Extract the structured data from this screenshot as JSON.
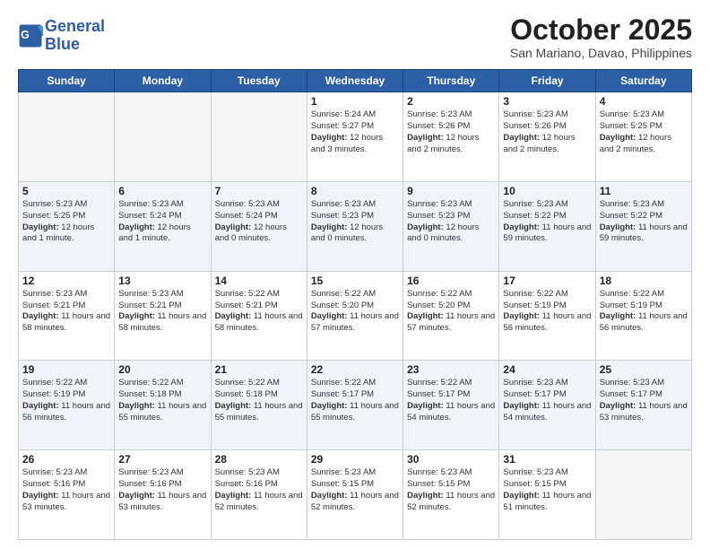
{
  "header": {
    "logo_line1": "General",
    "logo_line2": "Blue",
    "month": "October 2025",
    "location": "San Mariano, Davao, Philippines"
  },
  "weekdays": [
    "Sunday",
    "Monday",
    "Tuesday",
    "Wednesday",
    "Thursday",
    "Friday",
    "Saturday"
  ],
  "weeks": [
    [
      {
        "day": "",
        "text": ""
      },
      {
        "day": "",
        "text": ""
      },
      {
        "day": "",
        "text": ""
      },
      {
        "day": "1",
        "text": "Sunrise: 5:24 AM\nSunset: 5:27 PM\nDaylight: 12 hours and 3 minutes."
      },
      {
        "day": "2",
        "text": "Sunrise: 5:23 AM\nSunset: 5:26 PM\nDaylight: 12 hours and 2 minutes."
      },
      {
        "day": "3",
        "text": "Sunrise: 5:23 AM\nSunset: 5:26 PM\nDaylight: 12 hours and 2 minutes."
      },
      {
        "day": "4",
        "text": "Sunrise: 5:23 AM\nSunset: 5:25 PM\nDaylight: 12 hours and 2 minutes."
      }
    ],
    [
      {
        "day": "5",
        "text": "Sunrise: 5:23 AM\nSunset: 5:25 PM\nDaylight: 12 hours and 1 minute."
      },
      {
        "day": "6",
        "text": "Sunrise: 5:23 AM\nSunset: 5:24 PM\nDaylight: 12 hours and 1 minute."
      },
      {
        "day": "7",
        "text": "Sunrise: 5:23 AM\nSunset: 5:24 PM\nDaylight: 12 hours and 0 minutes."
      },
      {
        "day": "8",
        "text": "Sunrise: 5:23 AM\nSunset: 5:23 PM\nDaylight: 12 hours and 0 minutes."
      },
      {
        "day": "9",
        "text": "Sunrise: 5:23 AM\nSunset: 5:23 PM\nDaylight: 12 hours and 0 minutes."
      },
      {
        "day": "10",
        "text": "Sunrise: 5:23 AM\nSunset: 5:22 PM\nDaylight: 11 hours and 59 minutes."
      },
      {
        "day": "11",
        "text": "Sunrise: 5:23 AM\nSunset: 5:22 PM\nDaylight: 11 hours and 59 minutes."
      }
    ],
    [
      {
        "day": "12",
        "text": "Sunrise: 5:23 AM\nSunset: 5:21 PM\nDaylight: 11 hours and 58 minutes."
      },
      {
        "day": "13",
        "text": "Sunrise: 5:23 AM\nSunset: 5:21 PM\nDaylight: 11 hours and 58 minutes."
      },
      {
        "day": "14",
        "text": "Sunrise: 5:22 AM\nSunset: 5:21 PM\nDaylight: 11 hours and 58 minutes."
      },
      {
        "day": "15",
        "text": "Sunrise: 5:22 AM\nSunset: 5:20 PM\nDaylight: 11 hours and 57 minutes."
      },
      {
        "day": "16",
        "text": "Sunrise: 5:22 AM\nSunset: 5:20 PM\nDaylight: 11 hours and 57 minutes."
      },
      {
        "day": "17",
        "text": "Sunrise: 5:22 AM\nSunset: 5:19 PM\nDaylight: 11 hours and 56 minutes."
      },
      {
        "day": "18",
        "text": "Sunrise: 5:22 AM\nSunset: 5:19 PM\nDaylight: 11 hours and 56 minutes."
      }
    ],
    [
      {
        "day": "19",
        "text": "Sunrise: 5:22 AM\nSunset: 5:19 PM\nDaylight: 11 hours and 56 minutes."
      },
      {
        "day": "20",
        "text": "Sunrise: 5:22 AM\nSunset: 5:18 PM\nDaylight: 11 hours and 55 minutes."
      },
      {
        "day": "21",
        "text": "Sunrise: 5:22 AM\nSunset: 5:18 PM\nDaylight: 11 hours and 55 minutes."
      },
      {
        "day": "22",
        "text": "Sunrise: 5:22 AM\nSunset: 5:17 PM\nDaylight: 11 hours and 55 minutes."
      },
      {
        "day": "23",
        "text": "Sunrise: 5:22 AM\nSunset: 5:17 PM\nDaylight: 11 hours and 54 minutes."
      },
      {
        "day": "24",
        "text": "Sunrise: 5:23 AM\nSunset: 5:17 PM\nDaylight: 11 hours and 54 minutes."
      },
      {
        "day": "25",
        "text": "Sunrise: 5:23 AM\nSunset: 5:17 PM\nDaylight: 11 hours and 53 minutes."
      }
    ],
    [
      {
        "day": "26",
        "text": "Sunrise: 5:23 AM\nSunset: 5:16 PM\nDaylight: 11 hours and 53 minutes."
      },
      {
        "day": "27",
        "text": "Sunrise: 5:23 AM\nSunset: 5:16 PM\nDaylight: 11 hours and 53 minutes."
      },
      {
        "day": "28",
        "text": "Sunrise: 5:23 AM\nSunset: 5:16 PM\nDaylight: 11 hours and 52 minutes."
      },
      {
        "day": "29",
        "text": "Sunrise: 5:23 AM\nSunset: 5:15 PM\nDaylight: 11 hours and 52 minutes."
      },
      {
        "day": "30",
        "text": "Sunrise: 5:23 AM\nSunset: 5:15 PM\nDaylight: 11 hours and 52 minutes."
      },
      {
        "day": "31",
        "text": "Sunrise: 5:23 AM\nSunset: 5:15 PM\nDaylight: 11 hours and 51 minutes."
      },
      {
        "day": "",
        "text": ""
      }
    ]
  ]
}
